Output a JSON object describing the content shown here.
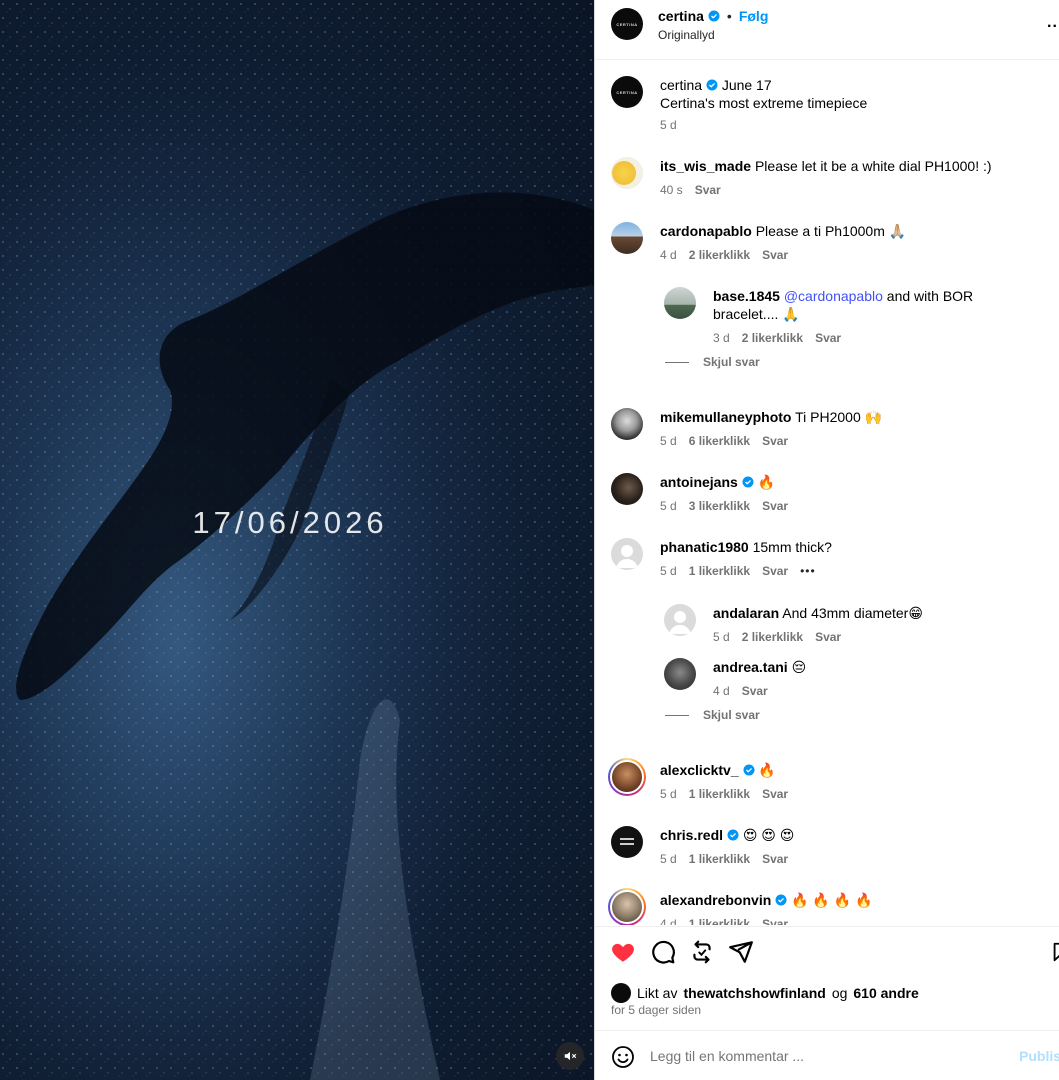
{
  "media": {
    "date_overlay": "17/06/2026",
    "mute_icon": "speaker-muted-icon"
  },
  "header": {
    "username": "certina",
    "separator": "•",
    "follow_label": "Følg",
    "subtitle": "Originallyd",
    "more_icon": "more-horizontal-icon",
    "more_label": ".."
  },
  "caption": {
    "username": "certina",
    "date": "June 17",
    "text": "Certina's most extreme timepiece",
    "time": "5 d"
  },
  "comments": [
    {
      "username": "its_wis_made",
      "text": "Please let it be a white dial PH1000! :)",
      "time": "40 s",
      "likes": "",
      "reply": "Svar"
    },
    {
      "username": "cardonapablo",
      "text": "Please a ti Ph1000m",
      "emoji": "🙏🏼",
      "time": "4 d",
      "likes": "2 likerklikk",
      "reply": "Svar"
    },
    {
      "username": "base.1845",
      "mention": "@cardonapablo",
      "text_a": "and with BOR",
      "text_b": "bracelet....",
      "emoji": "🙏",
      "time": "3 d",
      "likes": "2 likerklikk",
      "reply": "Svar"
    },
    {
      "username": "mikemullaneyphoto",
      "text": "Ti PH2000",
      "emoji": "🙌",
      "time": "5 d",
      "likes": "6 likerklikk",
      "reply": "Svar"
    },
    {
      "username": "antoinejans",
      "emoji": "🔥",
      "time": "5 d",
      "likes": "3 likerklikk",
      "reply": "Svar"
    },
    {
      "username": "phanatic1980",
      "text": "15mm thick?",
      "time": "5 d",
      "likes": "1 likerklikk",
      "reply": "Svar",
      "more": "•••"
    },
    {
      "username": "andalaran",
      "text": "And 43mm diameter",
      "emoji": "😁",
      "time": "5 d",
      "likes": "2 likerklikk",
      "reply": "Svar"
    },
    {
      "username": "andrea.tani",
      "emoji": "😔",
      "time": "4 d",
      "reply": "Svar"
    },
    {
      "username": "alexclicktv_",
      "emoji": "🔥",
      "time": "5 d",
      "likes": "1 likerklikk",
      "reply": "Svar"
    },
    {
      "username": "chris.redl",
      "emoji": "😍 😍 😍",
      "time": "5 d",
      "likes": "1 likerklikk",
      "reply": "Svar"
    },
    {
      "username": "alexandrebonvin",
      "emoji": "🔥 🔥 🔥 🔥",
      "time": "4 d",
      "likes": "1 likerklikk",
      "reply": "Svar"
    }
  ],
  "hide_replies_label": "Skjul svar",
  "actions": {
    "like_icon": "heart-filled-icon",
    "comment_icon": "comment-icon",
    "repost_icon": "repost-icon",
    "share_icon": "send-icon",
    "save_icon": "bookmark-icon"
  },
  "likes": {
    "prefix": "Likt av",
    "user": "thewatchshowfinland",
    "joiner": "og",
    "others": "610 andre"
  },
  "time_ago": "for 5 dager siden",
  "add_comment": {
    "placeholder": "Legg til en kommentar ...",
    "publish_label": "Publis",
    "emoji_icon": "smiley-icon"
  },
  "colors": {
    "accent": "#0095f6",
    "like_red": "#ff3040",
    "verified": "#0095f6",
    "muted_text": "#737373"
  }
}
